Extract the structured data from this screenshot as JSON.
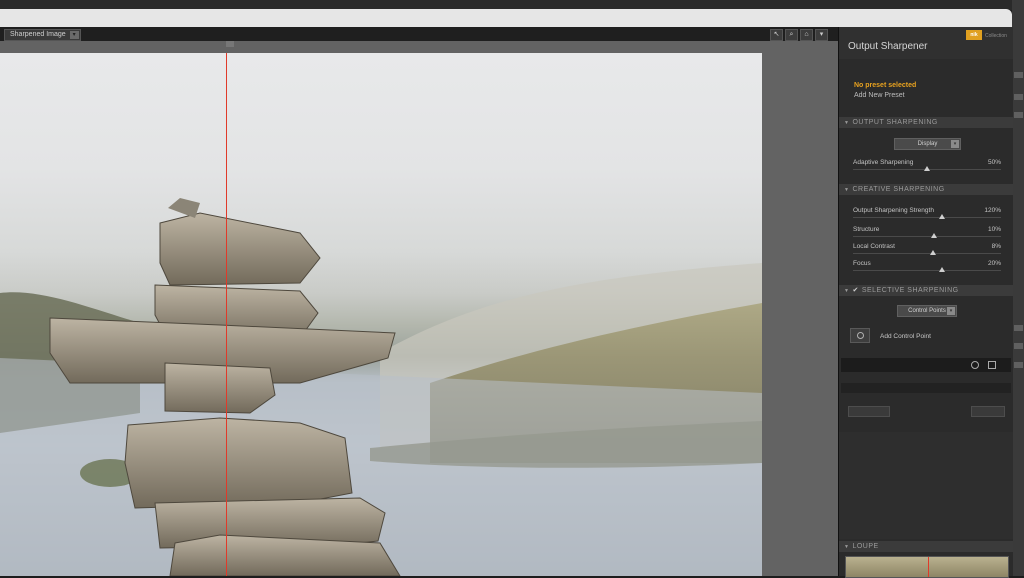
{
  "viewer": {
    "view_mode": "Sharpened Image",
    "tools": [
      "pointer-icon",
      "zoom-icon",
      "hand-icon",
      "info-icon"
    ]
  },
  "panel": {
    "title": "Output Sharpener",
    "brand_badge": "nik",
    "brand_text": "Collection",
    "preset_status": "No preset selected",
    "add_preset": "Add New Preset"
  },
  "output_sharpening": {
    "header": "OUTPUT SHARPENING",
    "mode": "Display",
    "sliders": [
      {
        "label": "Adaptive Sharpening",
        "value": "50%",
        "level": 0.5
      }
    ]
  },
  "creative_sharpening": {
    "header": "CREATIVE SHARPENING",
    "sliders": [
      {
        "label": "Output Sharpening Strength",
        "value": "120%",
        "level": 0.6
      },
      {
        "label": "Structure",
        "value": "10%",
        "level": 0.55
      },
      {
        "label": "Local Contrast",
        "value": "8%",
        "level": 0.54
      },
      {
        "label": "Focus",
        "value": "20%",
        "level": 0.6
      }
    ]
  },
  "selective_sharpening": {
    "header": "SELECTIVE SHARPENING",
    "check": "✔",
    "mode": "Control Points",
    "add_control_point": "Add Control Point"
  },
  "loupe": {
    "header": "LOUPE"
  },
  "colors": {
    "accent_warning": "#e8a21f",
    "split_line": "#e03a2a"
  }
}
